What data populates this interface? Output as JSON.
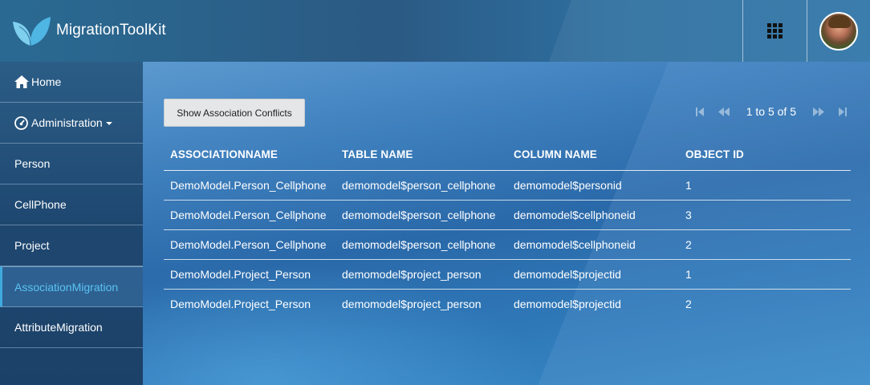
{
  "header": {
    "app_title": "MigrationToolKit",
    "logo_icon": "leaf-logo-icon",
    "apps_icon": "grid-icon",
    "avatar_icon": "user-avatar"
  },
  "sidebar": {
    "items": [
      {
        "label": "Home",
        "icon": "home-icon"
      },
      {
        "label": "Administration",
        "icon": "gauge-icon",
        "dropdown": true
      },
      {
        "label": "Person"
      },
      {
        "label": "CellPhone"
      },
      {
        "label": "Project"
      },
      {
        "label": "AssociationMigration",
        "active": true
      },
      {
        "label": "AttributeMigration"
      }
    ]
  },
  "main": {
    "conflicts_button": "Show Association Conflicts",
    "pager": {
      "text": "1 to 5 of 5",
      "first_icon": "first-page-icon",
      "prev_icon": "prev-page-icon",
      "next_icon": "next-page-icon",
      "last_icon": "last-page-icon"
    },
    "table": {
      "headers": [
        "ASSOCIATIONNAME",
        "TABLE NAME",
        "COLUMN NAME",
        "OBJECT ID"
      ],
      "rows": [
        [
          "DemoModel.Person_Cellphone",
          "demomodel$person_cellphone",
          "demomodel$personid",
          "1"
        ],
        [
          "DemoModel.Person_Cellphone",
          "demomodel$person_cellphone",
          "demomodel$cellphoneid",
          "3"
        ],
        [
          "DemoModel.Person_Cellphone",
          "demomodel$person_cellphone",
          "demomodel$cellphoneid",
          "2"
        ],
        [
          "DemoModel.Project_Person",
          "demomodel$project_person",
          "demomodel$projectid",
          "1"
        ],
        [
          "DemoModel.Project_Person",
          "demomodel$project_person",
          "demomodel$projectid",
          "2"
        ]
      ]
    }
  },
  "colors": {
    "active_nav_text": "#59c3f2",
    "button_bg": "#e4e6e8"
  }
}
